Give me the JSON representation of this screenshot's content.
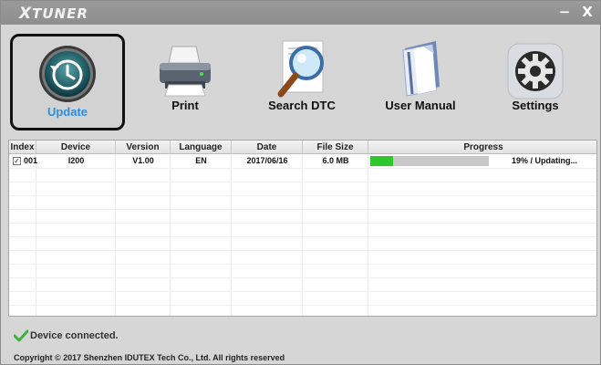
{
  "app": {
    "title_prefix": "X",
    "title_rest": "TUNER",
    "minimize_label": "−",
    "close_label": "X"
  },
  "toolbar": {
    "items": [
      {
        "label": "Update",
        "icon": "update-clock-icon",
        "active": true
      },
      {
        "label": "Print",
        "icon": "printer-icon",
        "active": false
      },
      {
        "label": "Search DTC",
        "icon": "magnifier-icon",
        "active": false
      },
      {
        "label": "User Manual",
        "icon": "manual-book-icon",
        "active": false
      },
      {
        "label": "Settings",
        "icon": "gear-icon",
        "active": false
      }
    ]
  },
  "table": {
    "headers": [
      "Index",
      "Device",
      "Version",
      "Language",
      "Date",
      "File Size",
      "Progress"
    ],
    "rows": [
      {
        "checked": true,
        "index": "001",
        "device": "I200",
        "version": "V1.00",
        "language": "EN",
        "date": "2017/06/16",
        "size": "6.0 MB",
        "progress_percent": 19,
        "progress_text": "19% / Updating..."
      }
    ]
  },
  "status": {
    "text": "Device connected.",
    "icon": "check-icon"
  },
  "footer": {
    "copyright": "Copyright © 2017 Shenzhen IDUTEX Tech Co., Ltd. All rights reserved"
  },
  "colors": {
    "accent": "#2a8fe0",
    "progress": "#2ec82e",
    "titlebar": "#8e8e8e"
  }
}
